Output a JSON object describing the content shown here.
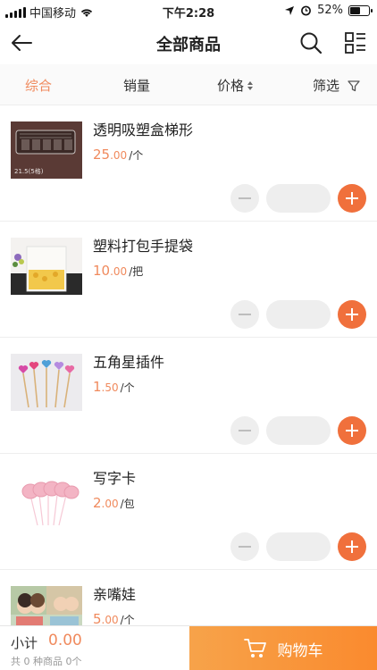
{
  "status_bar": {
    "carrier": "中国移动",
    "time": "下午2:28",
    "battery": "52%",
    "battery_level": 0.52
  },
  "header": {
    "title": "全部商品",
    "back_icon": "arrow-left-icon",
    "search_icon": "search-icon",
    "layout_icon": "grid-list-icon"
  },
  "filters": {
    "comprehensive": "综合",
    "sales": "销量",
    "price": "价格",
    "filter": "筛选",
    "active": "comprehensive",
    "accent_color": "#f08a5d"
  },
  "products": [
    {
      "name": "透明吸塑盒梯形",
      "price_int": "25",
      "price_dec": ".00",
      "unit": "/个",
      "image_text": "21.5(5格)"
    },
    {
      "name": "塑料打包手提袋",
      "price_int": "10",
      "price_dec": ".00",
      "unit": "/把"
    },
    {
      "name": "五角星插件",
      "price_int": "1",
      "price_dec": ".50",
      "unit": "/个"
    },
    {
      "name": "写字卡",
      "price_int": "2",
      "price_dec": ".00",
      "unit": "/包"
    },
    {
      "name": "亲嘴娃",
      "price_int": "5",
      "price_dec": ".00",
      "unit": "/个"
    }
  ],
  "cart": {
    "subtotal_label": "小计",
    "subtotal_value": "0.00",
    "summary": "共 0 种商品 0个",
    "button_label": "购物车",
    "button_icon": "cart-icon"
  }
}
